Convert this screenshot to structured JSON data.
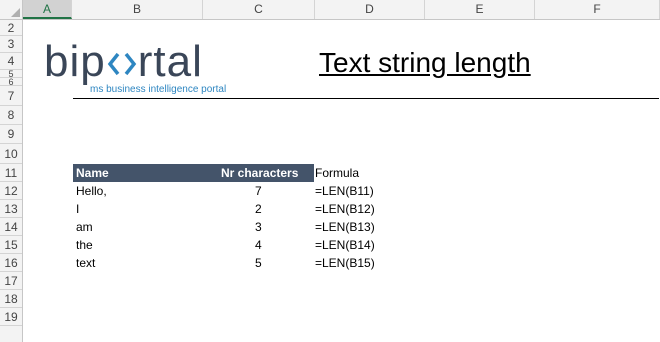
{
  "columns": [
    "A",
    "B",
    "C",
    "D",
    "E",
    "F"
  ],
  "rows": [
    "2",
    "3",
    "4",
    "5",
    "6",
    "7",
    "8",
    "9",
    "10",
    "11",
    "12",
    "13",
    "14",
    "15",
    "16",
    "17",
    "18",
    "19"
  ],
  "logo": {
    "text_left": "bip",
    "text_right": "rtal",
    "tagline": "ms business intelligence portal"
  },
  "title": "Text string length",
  "table": {
    "headers": {
      "name": "Name",
      "nr": "Nr characters",
      "formula": "Formula"
    },
    "rows": [
      {
        "name": "Hello,",
        "nr": "7",
        "formula": "=LEN(B11)"
      },
      {
        "name": "I",
        "nr": "2",
        "formula": "=LEN(B12)"
      },
      {
        "name": "am",
        "nr": "3",
        "formula": "=LEN(B13)"
      },
      {
        "name": "the",
        "nr": "4",
        "formula": "=LEN(B14)"
      },
      {
        "name": "text",
        "nr": "5",
        "formula": "=LEN(B15)"
      }
    ]
  },
  "colors": {
    "header_fill": "#44546a",
    "selected_accent": "#217346",
    "logo_dark": "#3a4658",
    "logo_blue": "#2e86c1"
  }
}
